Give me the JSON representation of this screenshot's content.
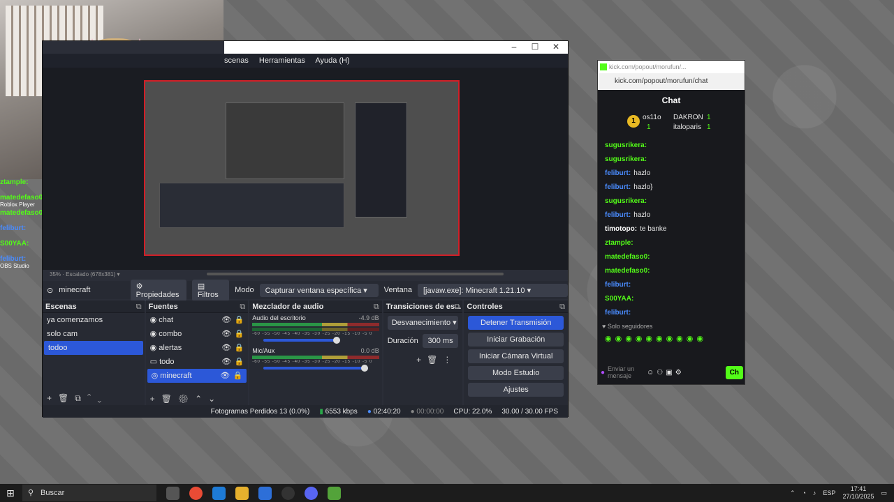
{
  "colors": {
    "accent": "#2c58d8",
    "kick_green": "#53fc18",
    "recording_red": "#d21f27"
  },
  "overlay_chat": [
    {
      "user": "ztample:",
      "color": "#53fc18"
    },
    {
      "user": "matedefaso0:",
      "color": "#53fc18"
    },
    {
      "user": "matedefaso0:",
      "color": "#53fc18"
    },
    {
      "user": "feliburt:",
      "color": "#4a8cff"
    },
    {
      "user": "S00YAA:",
      "color": "#53fc18"
    },
    {
      "user": "feliburt:",
      "color": "#4a8cff"
    }
  ],
  "overlay_tags": {
    "roblox": "Roblox Player",
    "obs": "OBS Studio"
  },
  "obs": {
    "menu": [
      "scenas",
      "Herramientas",
      "Ayuda (H)"
    ],
    "zoom": "35%",
    "scale": "Escalado (678x381)",
    "source_name": "minecraft",
    "properties_label": "Propiedades",
    "filters_label": "Filtros",
    "mode_label": "Modo",
    "mode_value": "Capturar ventana específica",
    "window_label": "Ventana",
    "window_value": "[javaw.exe]: Minecraft 1.21.10",
    "scenes": {
      "title": "Escenas",
      "items": [
        "ya comenzamos",
        "solo cam",
        "todoo"
      ]
    },
    "sources": {
      "title": "Fuentes",
      "items": [
        "chat",
        "combo",
        "alertas",
        "todo",
        "minecraft"
      ]
    },
    "mixer": {
      "title": "Mezclador de audio",
      "channels": [
        {
          "name": "Audio del escritorio",
          "db": "-4.9 dB"
        },
        {
          "name": "Mic/Aux",
          "db": "0.0 dB"
        }
      ],
      "ticks": "-60 -55 -50 -45 -40 -35 -30 -25 -20 -15 -10 -5 0"
    },
    "transitions": {
      "title": "Transiciones de es...",
      "value": "Desvanecimiento",
      "duration_label": "Duración",
      "duration_value": "300 ms"
    },
    "controls": {
      "title": "Controles",
      "stop_stream": "Detener Transmisión",
      "start_rec": "Iniciar Grabación",
      "virtual_cam": "Iniciar Cámara Virtual",
      "studio_mode": "Modo Estudio",
      "settings": "Ajustes"
    },
    "status": {
      "dropped": "Fotogramas Perdidos 13 (0.0%)",
      "bitrate": "6553 kbps",
      "stream_time": "02:40:20",
      "rec_time": "00:00:00",
      "cpu": "CPU: 22.0%",
      "fps": "30.00 / 30.00 FPS"
    }
  },
  "kick": {
    "window_title": "kick.com/popout/morufun/...",
    "url": "kick.com/popout/morufun/chat",
    "chat_title": "Chat",
    "gifters": [
      {
        "rank": "1",
        "name": "os11o",
        "count": "1"
      },
      {
        "name": "DAKRON",
        "count": "1"
      },
      {
        "name": "italoparis",
        "count": "1"
      }
    ],
    "messages": [
      {
        "user": "sugusrikera:",
        "text": "",
        "color": "#53fc18"
      },
      {
        "user": "sugusrikera:",
        "text": "",
        "color": "#53fc18"
      },
      {
        "user": "feliburt:",
        "text": "hazlo",
        "color": "#4a8cff"
      },
      {
        "user": "feliburt:",
        "text": "hazlo}",
        "color": "#4a8cff"
      },
      {
        "user": "sugusrikera:",
        "text": "",
        "color": "#53fc18"
      },
      {
        "user": "feliburt:",
        "text": "hazlo",
        "color": "#4a8cff"
      },
      {
        "user": "timotopo:",
        "text": "te banke",
        "color": "#ffffff"
      },
      {
        "user": "ztample:",
        "text": "",
        "color": "#53fc18"
      },
      {
        "user": "matedefaso0:",
        "text": "",
        "color": "#53fc18"
      },
      {
        "user": "matedefaso0:",
        "text": "",
        "color": "#53fc18"
      },
      {
        "user": "feliburt:",
        "text": "",
        "color": "#4a8cff"
      },
      {
        "user": "S00YAA:",
        "text": "",
        "color": "#53fc18"
      },
      {
        "user": "feliburt:",
        "text": "",
        "color": "#4a8cff"
      }
    ],
    "followers_only": "Solo seguidores",
    "input_placeholder": "Enviar un mensaje",
    "send_label": "Ch"
  },
  "taskbar": {
    "search_placeholder": "Buscar",
    "lang": "ESP",
    "time": "17:41",
    "date": "27/10/2025"
  }
}
